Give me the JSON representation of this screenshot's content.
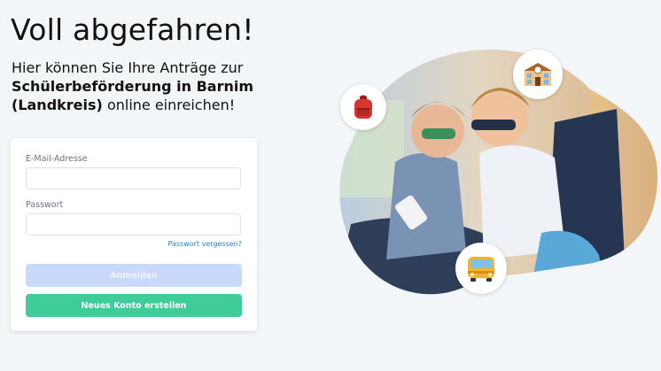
{
  "hero": {
    "headline": "Voll abgefahren!",
    "sub_part1": "Hier können Sie Ihre Anträge zur ",
    "sub_bold": "Schülerbeförderung in Barnim (Landkreis)",
    "sub_part2": " online einreichen!"
  },
  "login_form": {
    "email_label": "E-Mail-Adresse",
    "email_value": "",
    "password_label": "Passwort",
    "password_value": "",
    "forgot_link": "Passwort vergessen?",
    "login_button": "Anmelden",
    "register_button": "Neues Konto erstellen"
  },
  "illustration": {
    "icons": [
      "backpack-icon",
      "school-building-icon",
      "bus-icon"
    ],
    "colors": {
      "login_button_disabled": "#c9d9fb",
      "register_button": "#3ecd98",
      "link": "#2a7fc1"
    }
  }
}
